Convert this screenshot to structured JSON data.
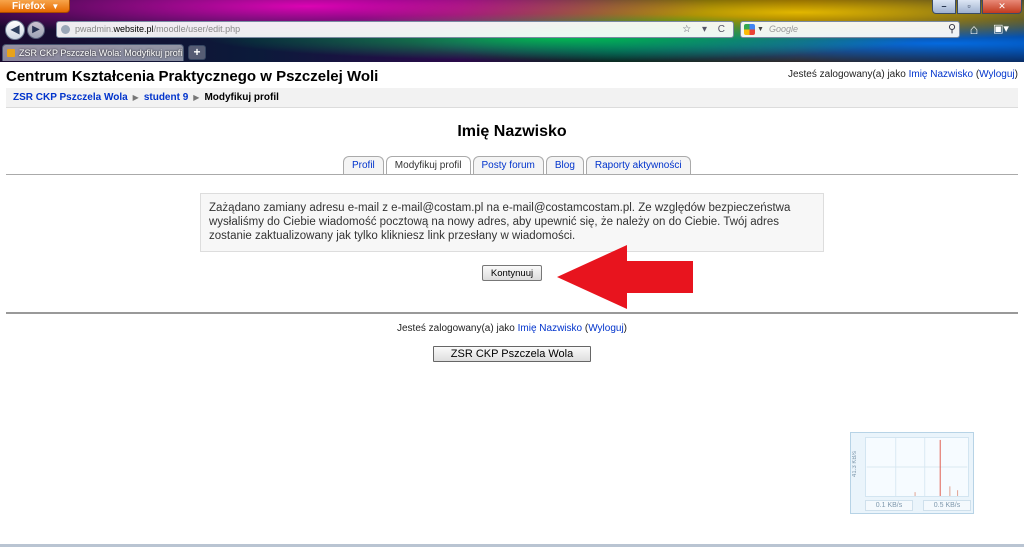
{
  "browser": {
    "menu_label": "Firefox",
    "window_buttons": {
      "minimize": "–",
      "maximize": "▫",
      "close": "✕"
    },
    "url": {
      "prefix": "pwadmin.",
      "host": "website.pl",
      "path": "/moodle/user/edit.php",
      "tools": "☆ ▾ C"
    },
    "search": {
      "placeholder": "Google"
    },
    "tab": {
      "title": "ZSR CKP Pszczela Wola: Modyfikuj profil"
    },
    "new_tab": "+"
  },
  "header": {
    "site_title": "Centrum Kształcenia Praktycznego w Pszczelej Woli",
    "login_prefix": "Jesteś zalogowany(a) jako",
    "user_name": "Imię Nazwisko",
    "logout_label": "Wyloguj"
  },
  "breadcrumb": {
    "items": [
      {
        "label": "ZSR CKP Pszczela Wola"
      },
      {
        "label": "student 9"
      },
      {
        "label": "Modyfikuj profil"
      }
    ],
    "separator": "▶"
  },
  "profile": {
    "heading": "Imię Nazwisko",
    "tabs": [
      {
        "label": "Profil"
      },
      {
        "label": "Modyfikuj profil"
      },
      {
        "label": "Posty forum"
      },
      {
        "label": "Blog"
      },
      {
        "label": "Raporty aktywności"
      }
    ],
    "notice": "Zażądano zamiany adresu e-mail z e-mail@costam.pl na e-mail@costamcostam.pl. Ze względów bezpieczeństwa wysłaliśmy do Ciebie wiadomość pocztową na nowy adres, aby upewnić się, że należy on do Ciebie. Twój adres zostanie zaktualizowany jak tylko klikniesz link przesłany w wiadomości.",
    "continue_label": "Kontynuuj"
  },
  "footer": {
    "login_prefix": "Jesteś zalogowany(a) jako",
    "user_name": "Imię Nazwisko",
    "logout_label": "Wyloguj",
    "home_button": "ZSR CKP Pszczela Wola"
  },
  "net_monitor": {
    "scale_label": "41.3 KB/s",
    "down_rate": "0.1 KB/s",
    "up_rate": "0.5 KB/s"
  },
  "colors": {
    "link": "#0033cc",
    "annotation_arrow": "#e8141e"
  }
}
